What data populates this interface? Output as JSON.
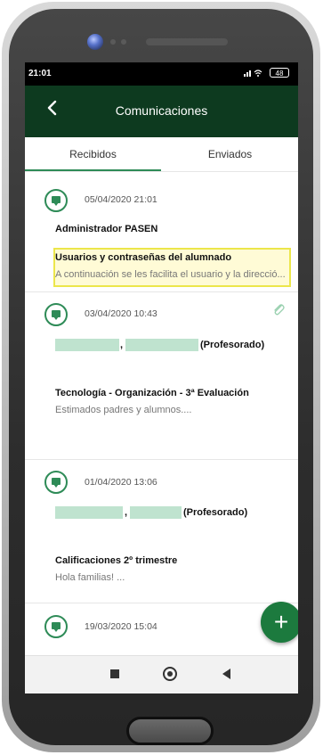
{
  "status_bar": {
    "time": "21:01",
    "battery": "48"
  },
  "app_bar": {
    "title": "Comunicaciones"
  },
  "tabs": [
    {
      "label": "Recibidos",
      "selected": true
    },
    {
      "label": "Enviados",
      "selected": false
    }
  ],
  "messages": [
    {
      "date": "05/04/2020 21:01",
      "sender": "Administrador PASEN",
      "subject": "Usuarios y contraseñas del alumnado",
      "preview": "A continuación se les facilita el usuario y la direcció...",
      "highlighted": true,
      "attachment": false
    },
    {
      "date": "03/04/2020 10:43",
      "sender_role": "(Profesorado)",
      "subject": "Tecnología - Organización - 3ª Evaluación",
      "preview": "Estimados padres y alumnos....",
      "highlighted": false,
      "attachment": true
    },
    {
      "date": "01/04/2020 13:06",
      "sender_role": "(Profesorado)",
      "subject": "Calificaciones 2º trimestre",
      "preview": "Hola familias! ...",
      "highlighted": false,
      "attachment": false
    },
    {
      "date": "19/03/2020 15:04"
    }
  ],
  "fab": {
    "label": "+"
  },
  "colors": {
    "app_bar": "#0d3a1f",
    "accent": "#2e8b57",
    "fab": "#1c7a3e",
    "highlight_border": "#ece64b",
    "highlight_bg": "#fffbd6",
    "redaction": "#bfe3cf"
  },
  "icons": {
    "back": "chevron-left-icon",
    "message": "chat-bubble-icon",
    "attachment": "paperclip-icon",
    "add": "plus-icon",
    "wifi": "wifi-icon",
    "signal": "signal-icon"
  }
}
